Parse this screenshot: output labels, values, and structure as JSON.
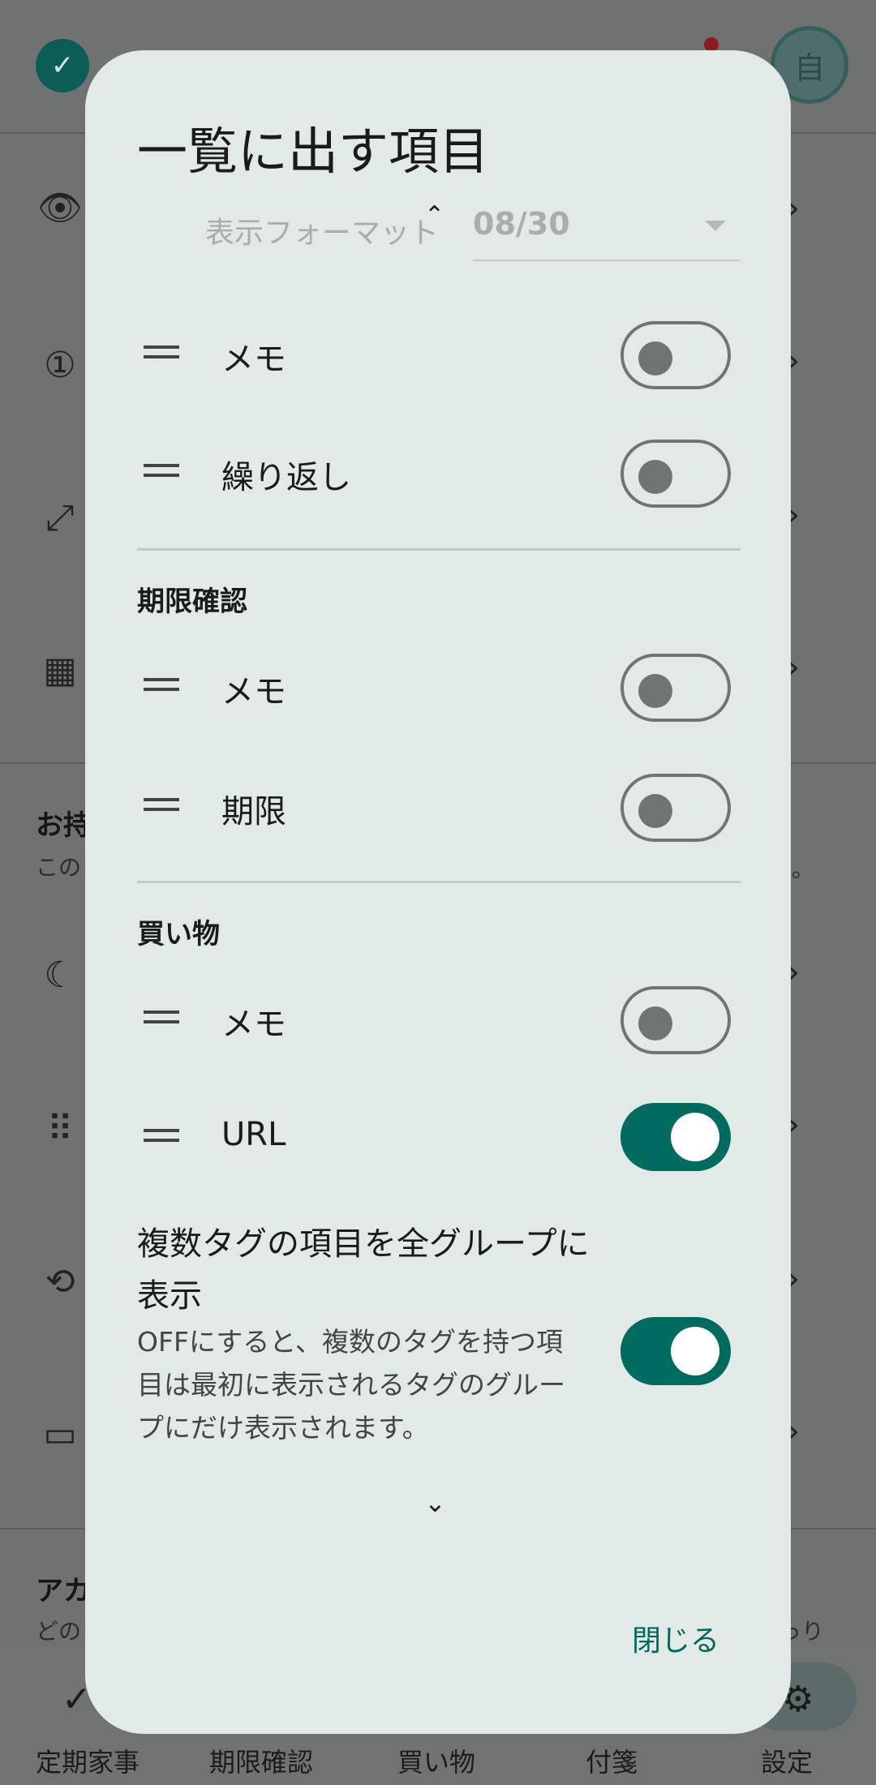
{
  "background": {
    "avatar_text": "自",
    "section_partial": "お持",
    "sub_partial": "この",
    "sub_right_partial": "。",
    "account_partial": "アカ",
    "account_sub_partial": "どの",
    "account_sub_right_partial": "っり",
    "nav": [
      "定期家事",
      "期限確認",
      "買い物",
      "付箋",
      "設定"
    ]
  },
  "dialog": {
    "title": "一覧に出す項目",
    "format_label": "表示フォーマット",
    "format_value": "08/30",
    "rows_top": [
      {
        "label": "メモ",
        "on": false
      },
      {
        "label": "繰り返し",
        "on": false
      }
    ],
    "groups": [
      {
        "header": "期限確認",
        "items": [
          {
            "label": "メモ",
            "on": false
          },
          {
            "label": "期限",
            "on": false
          }
        ]
      },
      {
        "header": "買い物",
        "items": [
          {
            "label": "メモ",
            "on": false
          },
          {
            "label": "URL",
            "on": true
          }
        ]
      }
    ],
    "multi_tag": {
      "title": "複数タグの項目を全グループに表示",
      "description": "OFFにすると、複数のタグを持つ項目は最初に表示されるタグのグループにだけ表示されます。",
      "on": true
    },
    "close_label": "閉じる"
  },
  "colors": {
    "accent": "#006b5f",
    "dialog_bg": "#e2eae7",
    "scrim": "#6f7271"
  }
}
